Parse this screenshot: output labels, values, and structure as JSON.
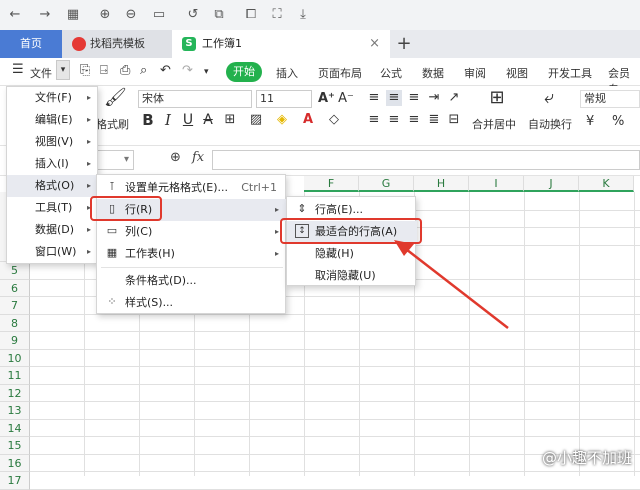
{
  "tabs": {
    "home": "首页",
    "template": "找稻壳模板",
    "workbook": "工作簿1",
    "close": "×",
    "add": "+"
  },
  "menubar": {
    "file": "文件",
    "start": "开始",
    "items": [
      "插入",
      "页面布局",
      "公式",
      "数据",
      "审阅",
      "视图",
      "开发工具",
      "会员专"
    ]
  },
  "ribbon": {
    "format_painter": "格式刷",
    "font_name": "宋体",
    "font_size": "11",
    "merge_center": "合并居中",
    "wrap_text": "自动换行",
    "number_format": "常规",
    "currency": "¥",
    "percent": "%"
  },
  "formula_bar": {
    "fx": "fx"
  },
  "columns": [
    "F",
    "G",
    "H",
    "I",
    "J",
    "K"
  ],
  "rows": [
    "5",
    "6",
    "7",
    "8",
    "9",
    "10",
    "11",
    "12",
    "13",
    "14",
    "15",
    "16",
    "17"
  ],
  "file_menu": [
    {
      "label": "文件(F)"
    },
    {
      "label": "编辑(E)"
    },
    {
      "label": "视图(V)"
    },
    {
      "label": "插入(I)"
    },
    {
      "label": "格式(O)"
    },
    {
      "label": "工具(T)"
    },
    {
      "label": "数据(D)"
    },
    {
      "label": "窗口(W)"
    }
  ],
  "format_menu": [
    {
      "label": "设置单元格格式(E)...",
      "shortcut": "Ctrl+1"
    },
    {
      "label": "行(R)"
    },
    {
      "label": "列(C)"
    },
    {
      "label": "工作表(H)"
    },
    {
      "label": "条件格式(D)..."
    },
    {
      "label": "样式(S)..."
    }
  ],
  "row_menu": [
    {
      "label": "行高(E)..."
    },
    {
      "label": "最适合的行高(A)"
    },
    {
      "label": "隐藏(H)"
    },
    {
      "label": "取消隐藏(U)"
    }
  ],
  "watermark": "@小趣不加班",
  "colors": {
    "accent_green": "#23b14d",
    "highlight_red": "#e0392d",
    "home_tab_blue": "#4a7bd4"
  }
}
